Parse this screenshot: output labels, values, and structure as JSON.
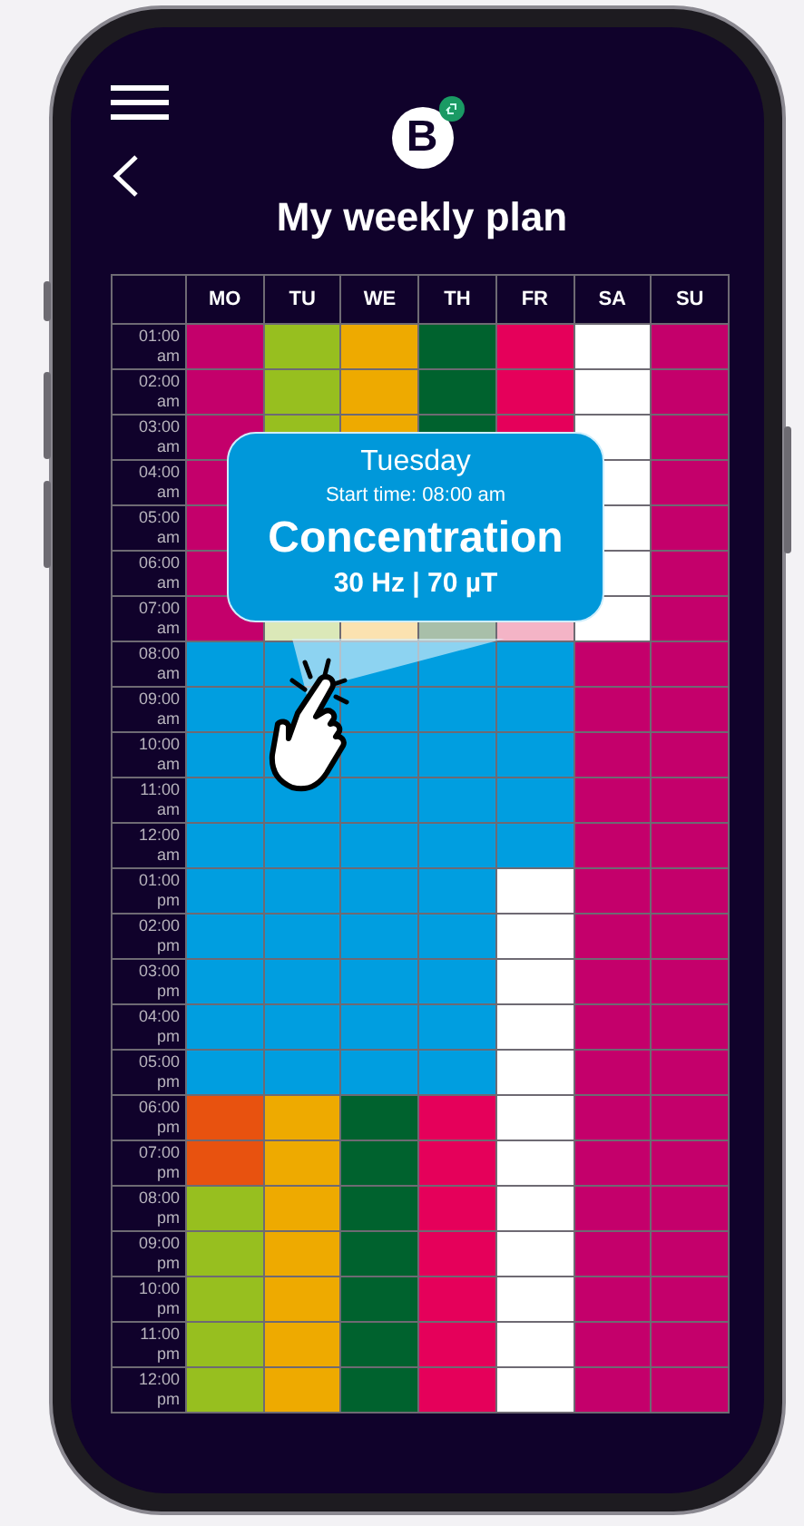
{
  "header": {
    "logo_letter": "B",
    "title": "My weekly plan"
  },
  "plan": {
    "days": [
      "MO",
      "TU",
      "WE",
      "TH",
      "FR",
      "SA",
      "SU"
    ],
    "rows": [
      {
        "time": "01:00 am",
        "cells": [
          {
            "color": "#c4006b"
          },
          {
            "color": "#97bf1f"
          },
          {
            "color": "#eeaa00"
          },
          {
            "color": "#00622e"
          },
          {
            "color": "#e5005a"
          },
          {
            "color": "#ffffff"
          },
          {
            "color": "#c4006b"
          }
        ]
      },
      {
        "time": "02:00 am",
        "cells": [
          {
            "color": "#c4006b"
          },
          {
            "color": "#97bf1f"
          },
          {
            "color": "#eeaa00"
          },
          {
            "color": "#00622e"
          },
          {
            "color": "#e5005a"
          },
          {
            "color": "#ffffff"
          },
          {
            "color": "#c4006b"
          }
        ]
      },
      {
        "time": "03:00 am",
        "cells": [
          {
            "color": "#c4006b"
          },
          {
            "color": "#97bf1f"
          },
          {
            "color": "#eeaa00"
          },
          {
            "color": "#00622e"
          },
          {
            "color": "#e5005a"
          },
          {
            "color": "#ffffff"
          },
          {
            "color": "#c4006b"
          }
        ]
      },
      {
        "time": "04:00 am",
        "cells": [
          {
            "color": "#c4006b"
          },
          {},
          {},
          {},
          {},
          {
            "color": "#ffffff"
          },
          {
            "color": "#c4006b"
          }
        ]
      },
      {
        "time": "05:00 am",
        "cells": [
          {
            "color": "#c4006b"
          },
          {},
          {},
          {},
          {},
          {
            "color": "#ffffff"
          },
          {
            "color": "#c4006b"
          }
        ]
      },
      {
        "time": "06:00 am",
        "cells": [
          {
            "color": "#c4006b"
          },
          {},
          {},
          {},
          {},
          {
            "color": "#ffffff"
          },
          {
            "color": "#c4006b"
          }
        ]
      },
      {
        "time": "07:00 am",
        "cells": [
          {
            "color": "#c4006b"
          },
          {
            "color": "#dbe8b8"
          },
          {
            "color": "#fbe2b0"
          },
          {
            "color": "#a8bfa9"
          },
          {
            "color": "#f4b4c6"
          },
          {
            "color": "#ffffff"
          },
          {
            "color": "#c4006b"
          }
        ]
      },
      {
        "time": "08:00 am",
        "cells": [
          {
            "color": "#009ee0"
          },
          {
            "color": "#009ee0"
          },
          {
            "color": "#009ee0"
          },
          {
            "color": "#009ee0"
          },
          {
            "color": "#009ee0"
          },
          {
            "color": "#c4006b"
          },
          {
            "color": "#c4006b"
          }
        ]
      },
      {
        "time": "09:00 am",
        "cells": [
          {
            "color": "#009ee0"
          },
          {
            "color": "#009ee0"
          },
          {
            "color": "#009ee0"
          },
          {
            "color": "#009ee0"
          },
          {
            "color": "#009ee0"
          },
          {
            "color": "#c4006b"
          },
          {
            "color": "#c4006b"
          }
        ]
      },
      {
        "time": "10:00 am",
        "cells": [
          {
            "color": "#009ee0"
          },
          {
            "color": "#009ee0"
          },
          {
            "color": "#009ee0"
          },
          {
            "color": "#009ee0"
          },
          {
            "color": "#009ee0"
          },
          {
            "color": "#c4006b"
          },
          {
            "color": "#c4006b"
          }
        ]
      },
      {
        "time": "11:00 am",
        "cells": [
          {
            "color": "#009ee0"
          },
          {
            "color": "#009ee0"
          },
          {
            "color": "#009ee0"
          },
          {
            "color": "#009ee0"
          },
          {
            "color": "#009ee0"
          },
          {
            "color": "#c4006b"
          },
          {
            "color": "#c4006b"
          }
        ]
      },
      {
        "time": "12:00 am",
        "cells": [
          {
            "color": "#009ee0"
          },
          {
            "color": "#009ee0"
          },
          {
            "color": "#009ee0"
          },
          {
            "color": "#009ee0"
          },
          {
            "color": "#009ee0"
          },
          {
            "color": "#c4006b"
          },
          {
            "color": "#c4006b"
          }
        ]
      },
      {
        "time": "01:00 pm",
        "cells": [
          {
            "color": "#009ee0"
          },
          {
            "color": "#009ee0"
          },
          {
            "color": "#009ee0"
          },
          {
            "color": "#009ee0"
          },
          {
            "color": "#ffffff"
          },
          {
            "color": "#c4006b"
          },
          {
            "color": "#c4006b"
          }
        ]
      },
      {
        "time": "02:00 pm",
        "cells": [
          {
            "color": "#009ee0"
          },
          {
            "color": "#009ee0"
          },
          {
            "color": "#009ee0"
          },
          {
            "color": "#009ee0"
          },
          {
            "color": "#ffffff"
          },
          {
            "color": "#c4006b"
          },
          {
            "color": "#c4006b"
          }
        ]
      },
      {
        "time": "03:00 pm",
        "cells": [
          {
            "color": "#009ee0"
          },
          {
            "color": "#009ee0"
          },
          {
            "color": "#009ee0"
          },
          {
            "color": "#009ee0"
          },
          {
            "color": "#ffffff"
          },
          {
            "color": "#c4006b"
          },
          {
            "color": "#c4006b"
          }
        ]
      },
      {
        "time": "04:00 pm",
        "cells": [
          {
            "color": "#009ee0"
          },
          {
            "color": "#009ee0"
          },
          {
            "color": "#009ee0"
          },
          {
            "color": "#009ee0"
          },
          {
            "color": "#ffffff"
          },
          {
            "color": "#c4006b"
          },
          {
            "color": "#c4006b"
          }
        ]
      },
      {
        "time": "05:00 pm",
        "cells": [
          {
            "color": "#009ee0"
          },
          {
            "color": "#009ee0"
          },
          {
            "color": "#009ee0"
          },
          {
            "color": "#009ee0"
          },
          {
            "color": "#ffffff"
          },
          {
            "color": "#c4006b"
          },
          {
            "color": "#c4006b"
          }
        ]
      },
      {
        "time": "06:00 pm",
        "cells": [
          {
            "color": "#e8520f"
          },
          {
            "color": "#eeaa00"
          },
          {
            "color": "#00622e"
          },
          {
            "color": "#e5005a"
          },
          {
            "color": "#ffffff"
          },
          {
            "color": "#c4006b"
          },
          {
            "color": "#c4006b"
          }
        ]
      },
      {
        "time": "07:00 pm",
        "cells": [
          {
            "color": "#e8520f"
          },
          {
            "color": "#eeaa00"
          },
          {
            "color": "#00622e"
          },
          {
            "color": "#e5005a"
          },
          {
            "color": "#ffffff"
          },
          {
            "color": "#c4006b"
          },
          {
            "color": "#c4006b"
          }
        ]
      },
      {
        "time": "08:00 pm",
        "cells": [
          {
            "color": "#97bf1f"
          },
          {
            "color": "#eeaa00"
          },
          {
            "color": "#00622e"
          },
          {
            "color": "#e5005a"
          },
          {
            "color": "#ffffff"
          },
          {
            "color": "#c4006b"
          },
          {
            "color": "#c4006b"
          }
        ]
      },
      {
        "time": "09:00 pm",
        "cells": [
          {
            "color": "#97bf1f"
          },
          {
            "color": "#eeaa00"
          },
          {
            "color": "#00622e"
          },
          {
            "color": "#e5005a"
          },
          {
            "color": "#ffffff"
          },
          {
            "color": "#c4006b"
          },
          {
            "color": "#c4006b"
          }
        ]
      },
      {
        "time": "10:00 pm",
        "cells": [
          {
            "color": "#97bf1f"
          },
          {
            "color": "#eeaa00"
          },
          {
            "color": "#00622e"
          },
          {
            "color": "#e5005a"
          },
          {
            "color": "#ffffff"
          },
          {
            "color": "#c4006b"
          },
          {
            "color": "#c4006b"
          }
        ]
      },
      {
        "time": "11:00 pm",
        "cells": [
          {
            "color": "#97bf1f"
          },
          {
            "color": "#eeaa00"
          },
          {
            "color": "#00622e"
          },
          {
            "color": "#e5005a"
          },
          {
            "color": "#ffffff"
          },
          {
            "color": "#c4006b"
          },
          {
            "color": "#c4006b"
          }
        ]
      },
      {
        "time": "12:00 pm",
        "cells": [
          {
            "color": "#97bf1f"
          },
          {
            "color": "#eeaa00"
          },
          {
            "color": "#00622e"
          },
          {
            "color": "#e5005a"
          },
          {
            "color": "#ffffff"
          },
          {
            "color": "#c4006b"
          },
          {
            "color": "#c4006b"
          }
        ]
      }
    ]
  },
  "tooltip": {
    "day": "Tuesday",
    "start": "Start time: 08:00 am",
    "program": "Concentration",
    "detail": "30 Hz | 70 µT"
  }
}
